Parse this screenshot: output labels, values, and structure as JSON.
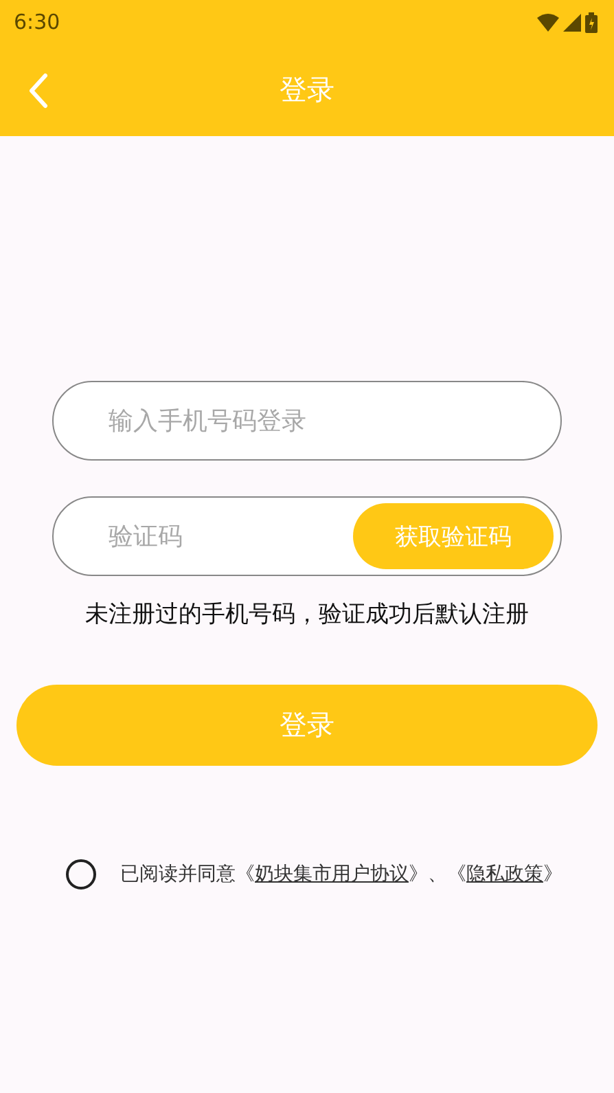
{
  "status_bar": {
    "time": "6:30"
  },
  "app_bar": {
    "title": "登录"
  },
  "phone_field": {
    "placeholder": "输入手机号码登录"
  },
  "code_field": {
    "placeholder": "验证码"
  },
  "get_code_button": {
    "label": "获取验证码"
  },
  "hint": "未注册过的手机号码，验证成功后默认注册",
  "login_button": {
    "label": "登录"
  },
  "agreement": {
    "checked": false,
    "parts": [
      {
        "kind": "text",
        "text": "已阅读并同意《"
      },
      {
        "kind": "link",
        "text": "奶块集市用户协议"
      },
      {
        "kind": "text",
        "text": "》、《"
      },
      {
        "kind": "link",
        "text": "隐私政策"
      },
      {
        "kind": "text",
        "text": "》"
      }
    ]
  }
}
